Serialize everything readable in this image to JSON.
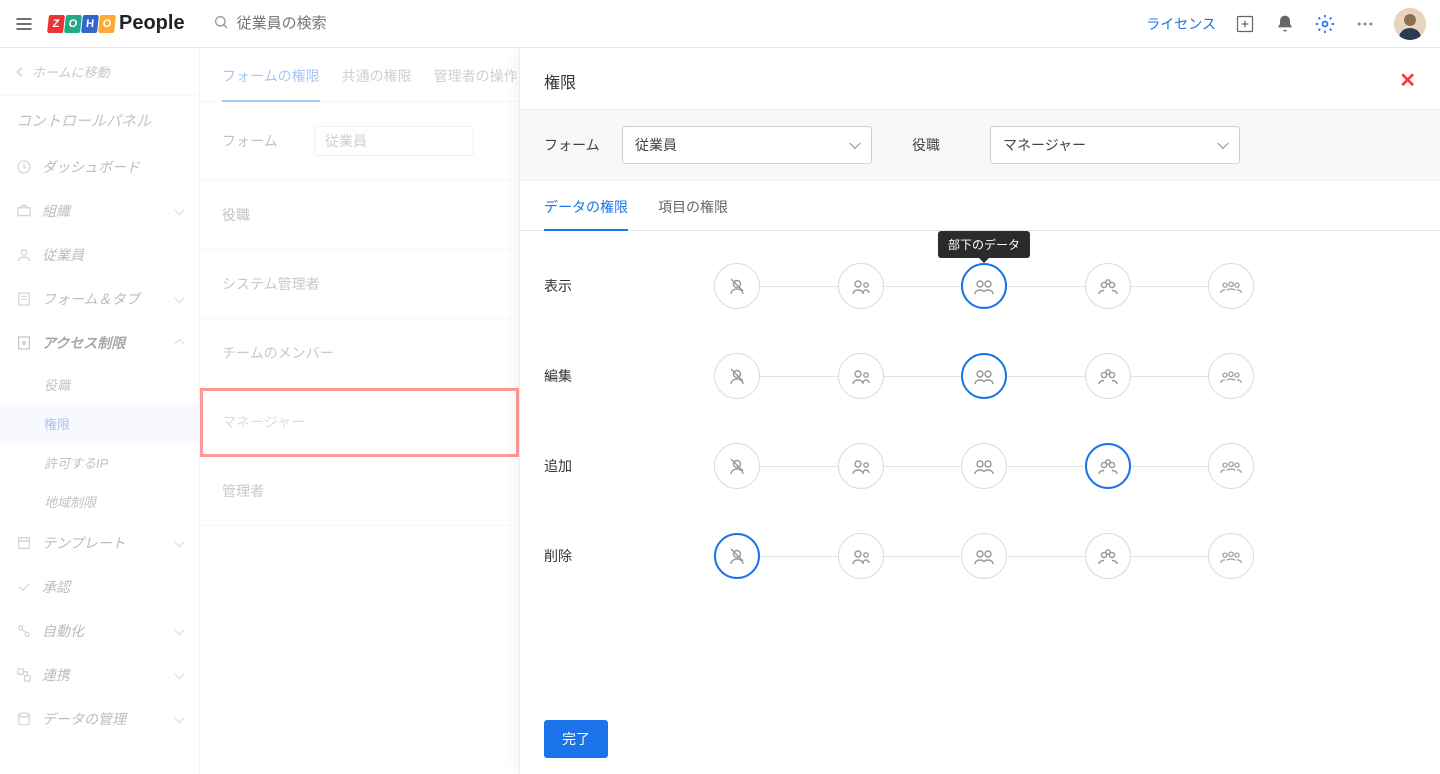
{
  "header": {
    "logo_text": "People",
    "search_placeholder": "従業員の検索",
    "license_link": "ライセンス"
  },
  "sidebar": {
    "back_label": "ホームに移動",
    "title": "コントロールパネル",
    "items": [
      {
        "label": "ダッシュボード"
      },
      {
        "label": "組織"
      },
      {
        "label": "従業員"
      },
      {
        "label": "フォーム＆タブ"
      },
      {
        "label": "アクセス制限"
      },
      {
        "label": "テンプレート"
      },
      {
        "label": "承認"
      },
      {
        "label": "自動化"
      },
      {
        "label": "連携"
      },
      {
        "label": "データの管理"
      }
    ],
    "access_sub": [
      {
        "label": "役職"
      },
      {
        "label": "権限"
      },
      {
        "label": "許可するIP"
      },
      {
        "label": "地域制限"
      }
    ]
  },
  "midcol": {
    "tabs": [
      {
        "label": "フォームの権限"
      },
      {
        "label": "共通の権限"
      },
      {
        "label": "管理者の操作"
      }
    ],
    "form_label": "フォーム",
    "form_value": "従業員",
    "role_label": "役職",
    "roles": [
      {
        "label": "システム管理者"
      },
      {
        "label": "チームのメンバー"
      },
      {
        "label": "マネージャー"
      },
      {
        "label": "管理者"
      }
    ]
  },
  "panel": {
    "title": "権限",
    "filter_form_label": "フォーム",
    "filter_form_value": "従業員",
    "filter_role_label": "役職",
    "filter_role_value": "マネージャー",
    "tabs": [
      {
        "label": "データの権限"
      },
      {
        "label": "項目の権限"
      }
    ],
    "tooltip": "部下のデータ",
    "perm_rows": [
      {
        "label": "表示",
        "selected": 2
      },
      {
        "label": "編集",
        "selected": 2
      },
      {
        "label": "追加",
        "selected": 3
      },
      {
        "label": "削除",
        "selected": 0
      }
    ],
    "done_label": "完了"
  }
}
